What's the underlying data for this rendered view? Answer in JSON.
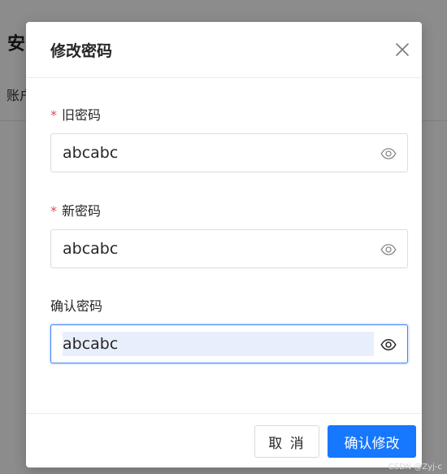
{
  "background": {
    "title": "安",
    "tab": "账户"
  },
  "modal": {
    "title": "修改密码",
    "close_icon": "close-icon"
  },
  "form": {
    "old_password": {
      "label": "旧密码",
      "required_mark": "*",
      "value": "abcabc",
      "icon": "eye-icon"
    },
    "new_password": {
      "label": "新密码",
      "required_mark": "*",
      "value": "abcabc",
      "icon": "eye-icon"
    },
    "confirm_password": {
      "label": "确认密码",
      "value": "abcabc",
      "icon": "eye-icon"
    }
  },
  "footer": {
    "cancel_label": "取 消",
    "confirm_label": "确认修改"
  },
  "watermark": "CSDN @Zyj-c",
  "colors": {
    "primary": "#1677ff",
    "required": "#e34d59",
    "overlay": "rgba(0,0,0,0.45)"
  }
}
